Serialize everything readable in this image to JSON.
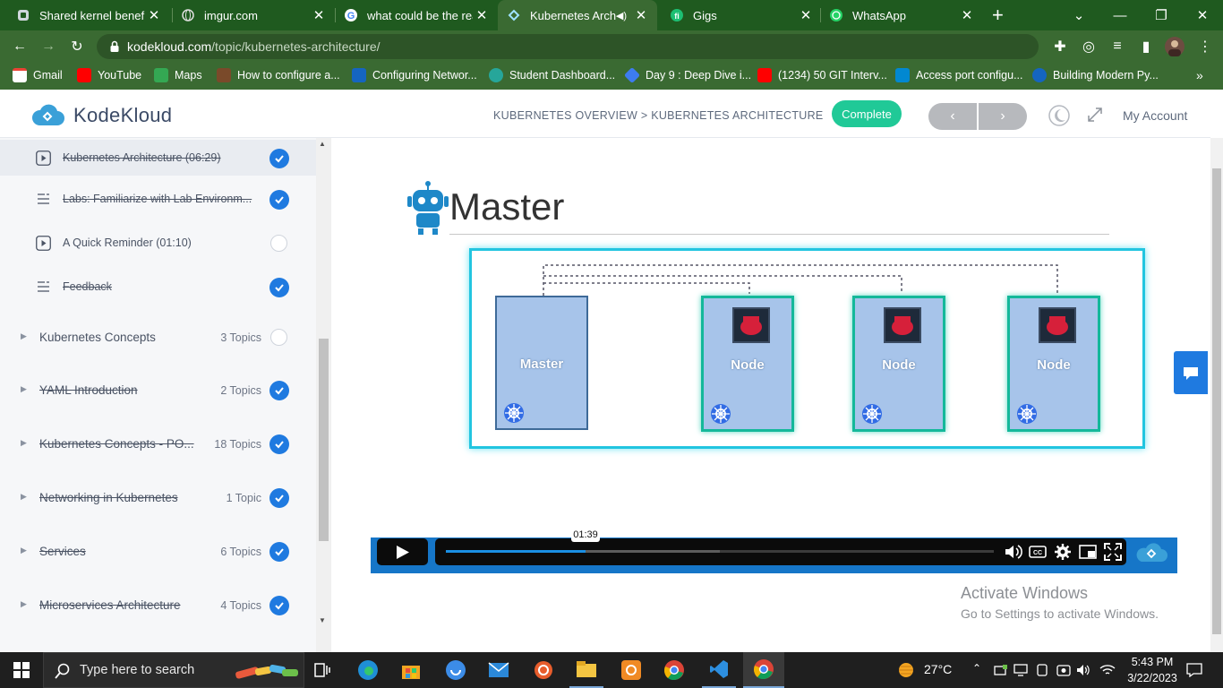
{
  "browser": {
    "tabs": [
      {
        "title": "Shared kernel benefits",
        "active": false
      },
      {
        "title": "imgur.com",
        "active": false
      },
      {
        "title": "what could be the rea",
        "active": false
      },
      {
        "title": "Kubernetes Archit",
        "active": true
      },
      {
        "title": "Gigs",
        "active": false
      },
      {
        "title": "WhatsApp",
        "active": false
      }
    ],
    "url_host": "kodekloud.com",
    "url_path": "/topic/kubernetes-architecture/",
    "bookmarks": [
      {
        "label": "Gmail",
        "color": "#ea4335"
      },
      {
        "label": "YouTube",
        "color": "#ff0000"
      },
      {
        "label": "Maps",
        "color": "#34a853"
      },
      {
        "label": "How to configure a...",
        "color": "#7a4a2a"
      },
      {
        "label": "Configuring Networ...",
        "color": "#1565c0"
      },
      {
        "label": "Student Dashboard...",
        "color": "#26a69a"
      },
      {
        "label": "Day 9 : Deep Dive i...",
        "color": "#3d7cf0"
      },
      {
        "label": "(1234) 50 GIT Interv...",
        "color": "#ff0000"
      },
      {
        "label": "Access port configu...",
        "color": "#0288d1"
      },
      {
        "label": "Building Modern Py...",
        "color": "#1565c0"
      }
    ]
  },
  "header": {
    "brand": "KodeKloud",
    "breadcrumb": "KUBERNETES OVERVIEW > KUBERNETES ARCHITECTURE",
    "complete_label": "Complete",
    "prev_label": "‹",
    "next_label": "›",
    "account_label": "My Account"
  },
  "sidebar": {
    "lessons": [
      {
        "title": "Kubernetes Architecture (06:29)",
        "icon": "play-icon",
        "done": true,
        "current": true
      },
      {
        "title": "Labs: Familiarize with Lab Environm...",
        "icon": "list-icon",
        "done": true,
        "current": false
      },
      {
        "title": "A Quick Reminder (01:10)",
        "icon": "play-icon",
        "done": false,
        "current": false
      },
      {
        "title": "Feedback",
        "icon": "list-icon",
        "done": true,
        "current": false
      }
    ],
    "sections": [
      {
        "title": "Kubernetes Concepts",
        "count": "3 Topics",
        "done": false
      },
      {
        "title": "YAML Introduction",
        "count": "2 Topics",
        "done": true
      },
      {
        "title": "Kubernetes Concepts - PO...",
        "count": "18 Topics",
        "done": true
      },
      {
        "title": "Networking in Kubernetes",
        "count": "1 Topic",
        "done": true
      },
      {
        "title": "Services",
        "count": "6 Topics",
        "done": true
      },
      {
        "title": "Microservices Architecture",
        "count": "4 Topics",
        "done": true
      }
    ]
  },
  "video": {
    "slide_title": "Master",
    "boxes": [
      "Master",
      "Node",
      "Node",
      "Node"
    ],
    "time_tooltip": "01:39",
    "played_fraction": 0.255,
    "loaded_fraction": 0.5
  },
  "watermark": {
    "line1": "Activate Windows",
    "line2": "Go to Settings to activate Windows."
  },
  "taskbar": {
    "search_placeholder": "Type here to search",
    "weather": "27°C",
    "time": "5:43 PM",
    "date": "3/22/2023"
  }
}
